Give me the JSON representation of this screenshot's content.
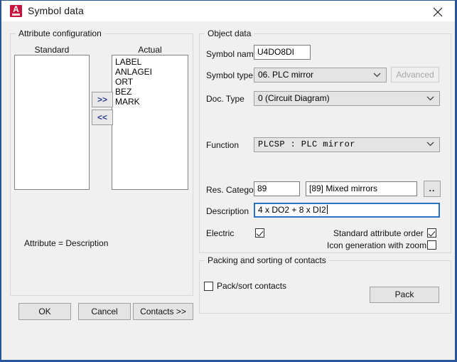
{
  "window": {
    "title": "Symbol data",
    "app_icon": "autocad-icon",
    "icon_letter": "A",
    "close_icon": "close-icon",
    "accent_color": "#2a5699",
    "icon_color": "#c8143c"
  },
  "attribute_configuration": {
    "group_title": "Attribute configuration",
    "standard_label": "Standard",
    "actual_label": "Actual",
    "standard_items": [],
    "actual_items": [
      "LABEL",
      "ANLAGEI",
      "ORT",
      "BEZ",
      "MARK"
    ],
    "add_button": ">>",
    "remove_button": "<<",
    "footer_note": "Attribute = Description"
  },
  "object_data": {
    "group_title": "Object data",
    "symbol_name_label": "Symbol name",
    "symbol_name_value": "U4DO8DI",
    "symbol_type_label": "Symbol type",
    "symbol_type_value": "06. PLC mirror",
    "advanced_button": "Advanced",
    "doc_type_label": "Doc. Type",
    "doc_type_value": "0 (Circuit Diagram)",
    "function_label": "Function",
    "function_value": "PLCSP : PLC mirror",
    "res_categor_label": "Res. Categor",
    "res_categor_value": "89",
    "res_categor_name": "[89] Mixed mirrors",
    "browse_button": "..",
    "description_label": "Description",
    "description_value": "4 x DO2 + 8 x DI2",
    "electric_label": "Electric",
    "electric_checked": true,
    "standard_attribute_order_label": "Standard attribute order",
    "standard_attribute_order_checked": true,
    "icon_generation_label": "Icon generation with zoom",
    "icon_generation_checked": false,
    "dropdown_arrow": "chevron-down-icon"
  },
  "packing": {
    "group_title": "Packing and sorting of contacts",
    "pack_sort_label": "Pack/sort contacts",
    "pack_sort_checked": false,
    "pack_button": "Pack"
  },
  "footer": {
    "ok": "OK",
    "cancel": "Cancel",
    "contacts": "Contacts >>"
  }
}
